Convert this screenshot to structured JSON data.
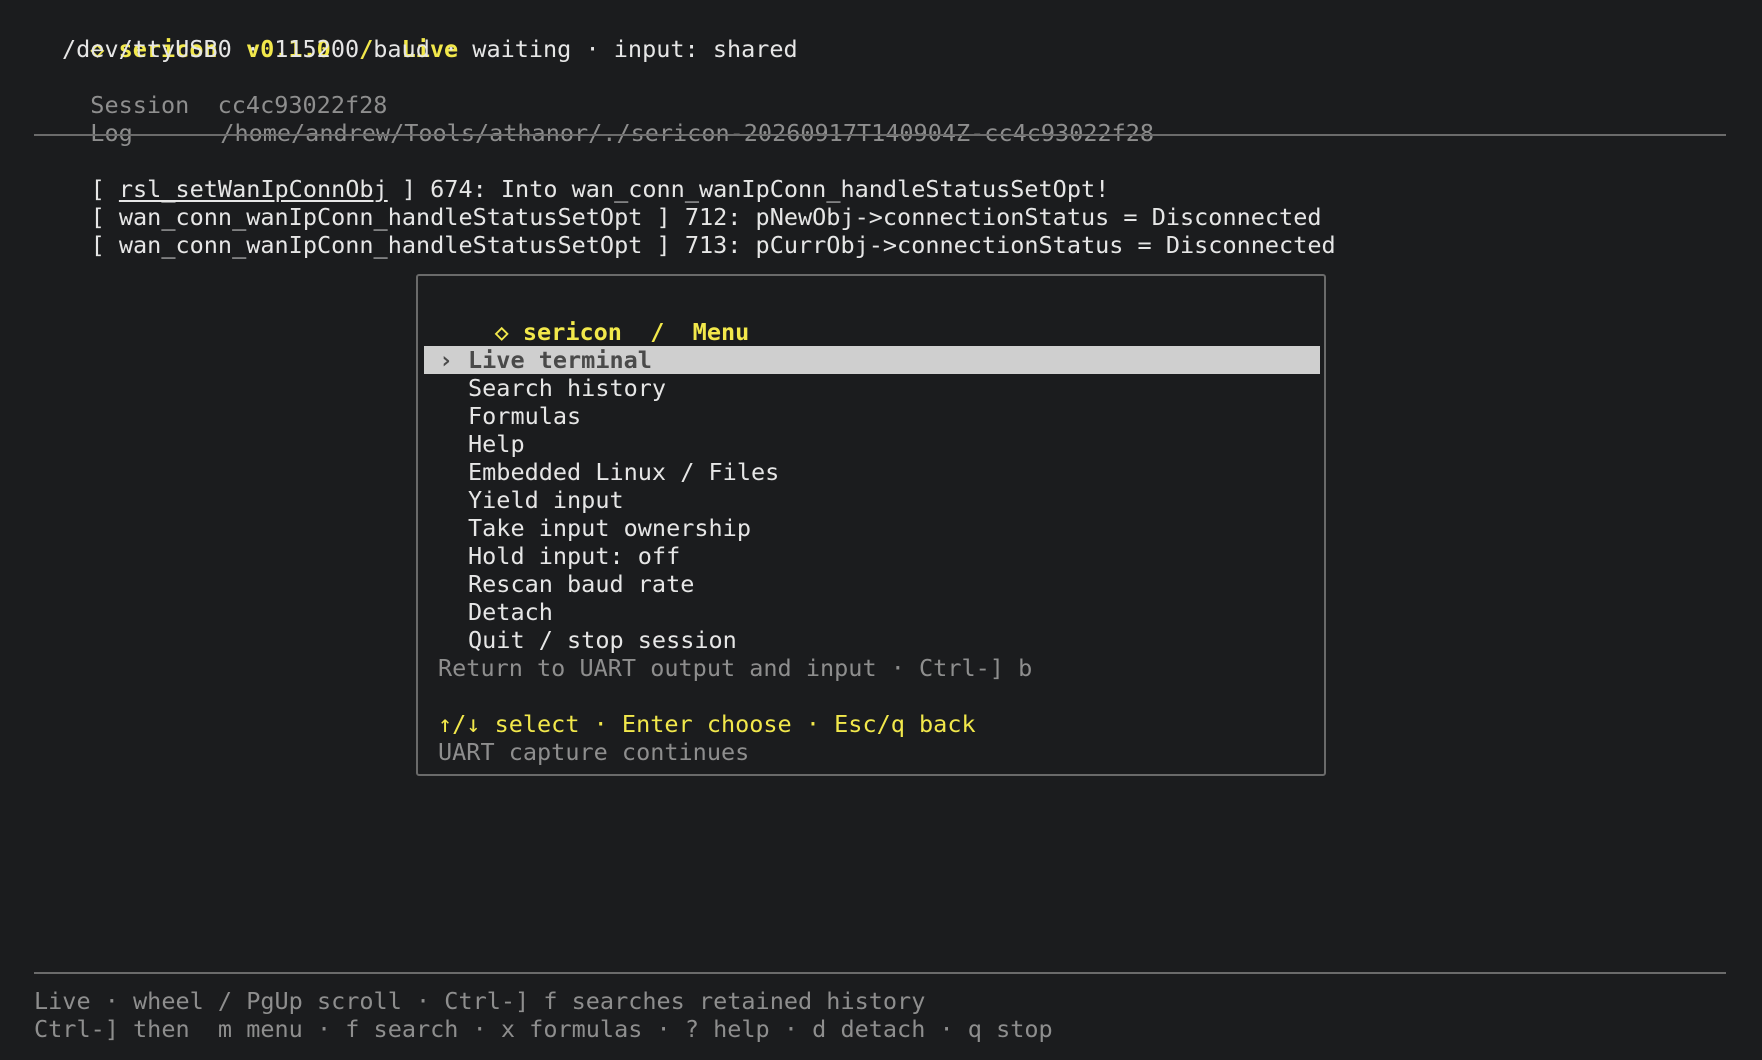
{
  "header": {
    "diamond_icon": "◇",
    "title": "sericon  v0.1.0  /  Live",
    "status": "/dev/ttyUSB0 · 115200 baud · waiting · input: shared",
    "session_label": "Session",
    "session_value": "cc4c93022f28",
    "log_label": "Log",
    "log_value": "/home/andrew/Tools/athanor/./sericon-20260917T140904Z-cc4c93022f28"
  },
  "terminal": {
    "lines": [
      {
        "prefix": "[ ",
        "fn": "rsl_setWanIpConnObj",
        "suffix": " ] 674: Into wan_conn_wanIpConn_handleStatusSetOpt!"
      },
      {
        "prefix": "[ ",
        "fn": "wan_conn_wanIpConn_handleStatusSetOpt",
        "suffix": " ] 712: pNewObj->connectionStatus = Disconnected"
      },
      {
        "prefix": "[ ",
        "fn": "wan_conn_wanIpConn_handleStatusSetOpt",
        "suffix": " ] 713: pCurrObj->connectionStatus = Disconnected"
      }
    ]
  },
  "menu": {
    "diamond_icon": "◇",
    "title": "sericon  /  Menu",
    "selected_caret": "›",
    "items": [
      {
        "label": "Live terminal",
        "selected": true
      },
      {
        "label": "Search history"
      },
      {
        "label": "Formulas"
      },
      {
        "label": "Help"
      },
      {
        "label": "Embedded Linux / Files"
      },
      {
        "label": "Yield input"
      },
      {
        "label": "Take input ownership"
      },
      {
        "label": "Hold input: off"
      },
      {
        "label": "Rescan baud rate"
      },
      {
        "label": "Detach"
      },
      {
        "label": "Quit / stop session"
      }
    ],
    "description": "Return to UART output and input · Ctrl-] b",
    "keys_hint": "↑/↓ select · Enter choose · Esc/q back",
    "capture_note": "UART capture continues"
  },
  "footer": {
    "line1": "Live · wheel / PgUp scroll · Ctrl-] f searches retained history",
    "line2": "Ctrl-] then  m menu · f search · x formulas · ? help · d detach · q stop"
  },
  "colors": {
    "background": "#1b1c1e",
    "accent_yellow": "#f2e84b",
    "text": "#e6e6e6",
    "dim_text": "#8e8e8e",
    "selection_bg": "#cfcfcf"
  }
}
